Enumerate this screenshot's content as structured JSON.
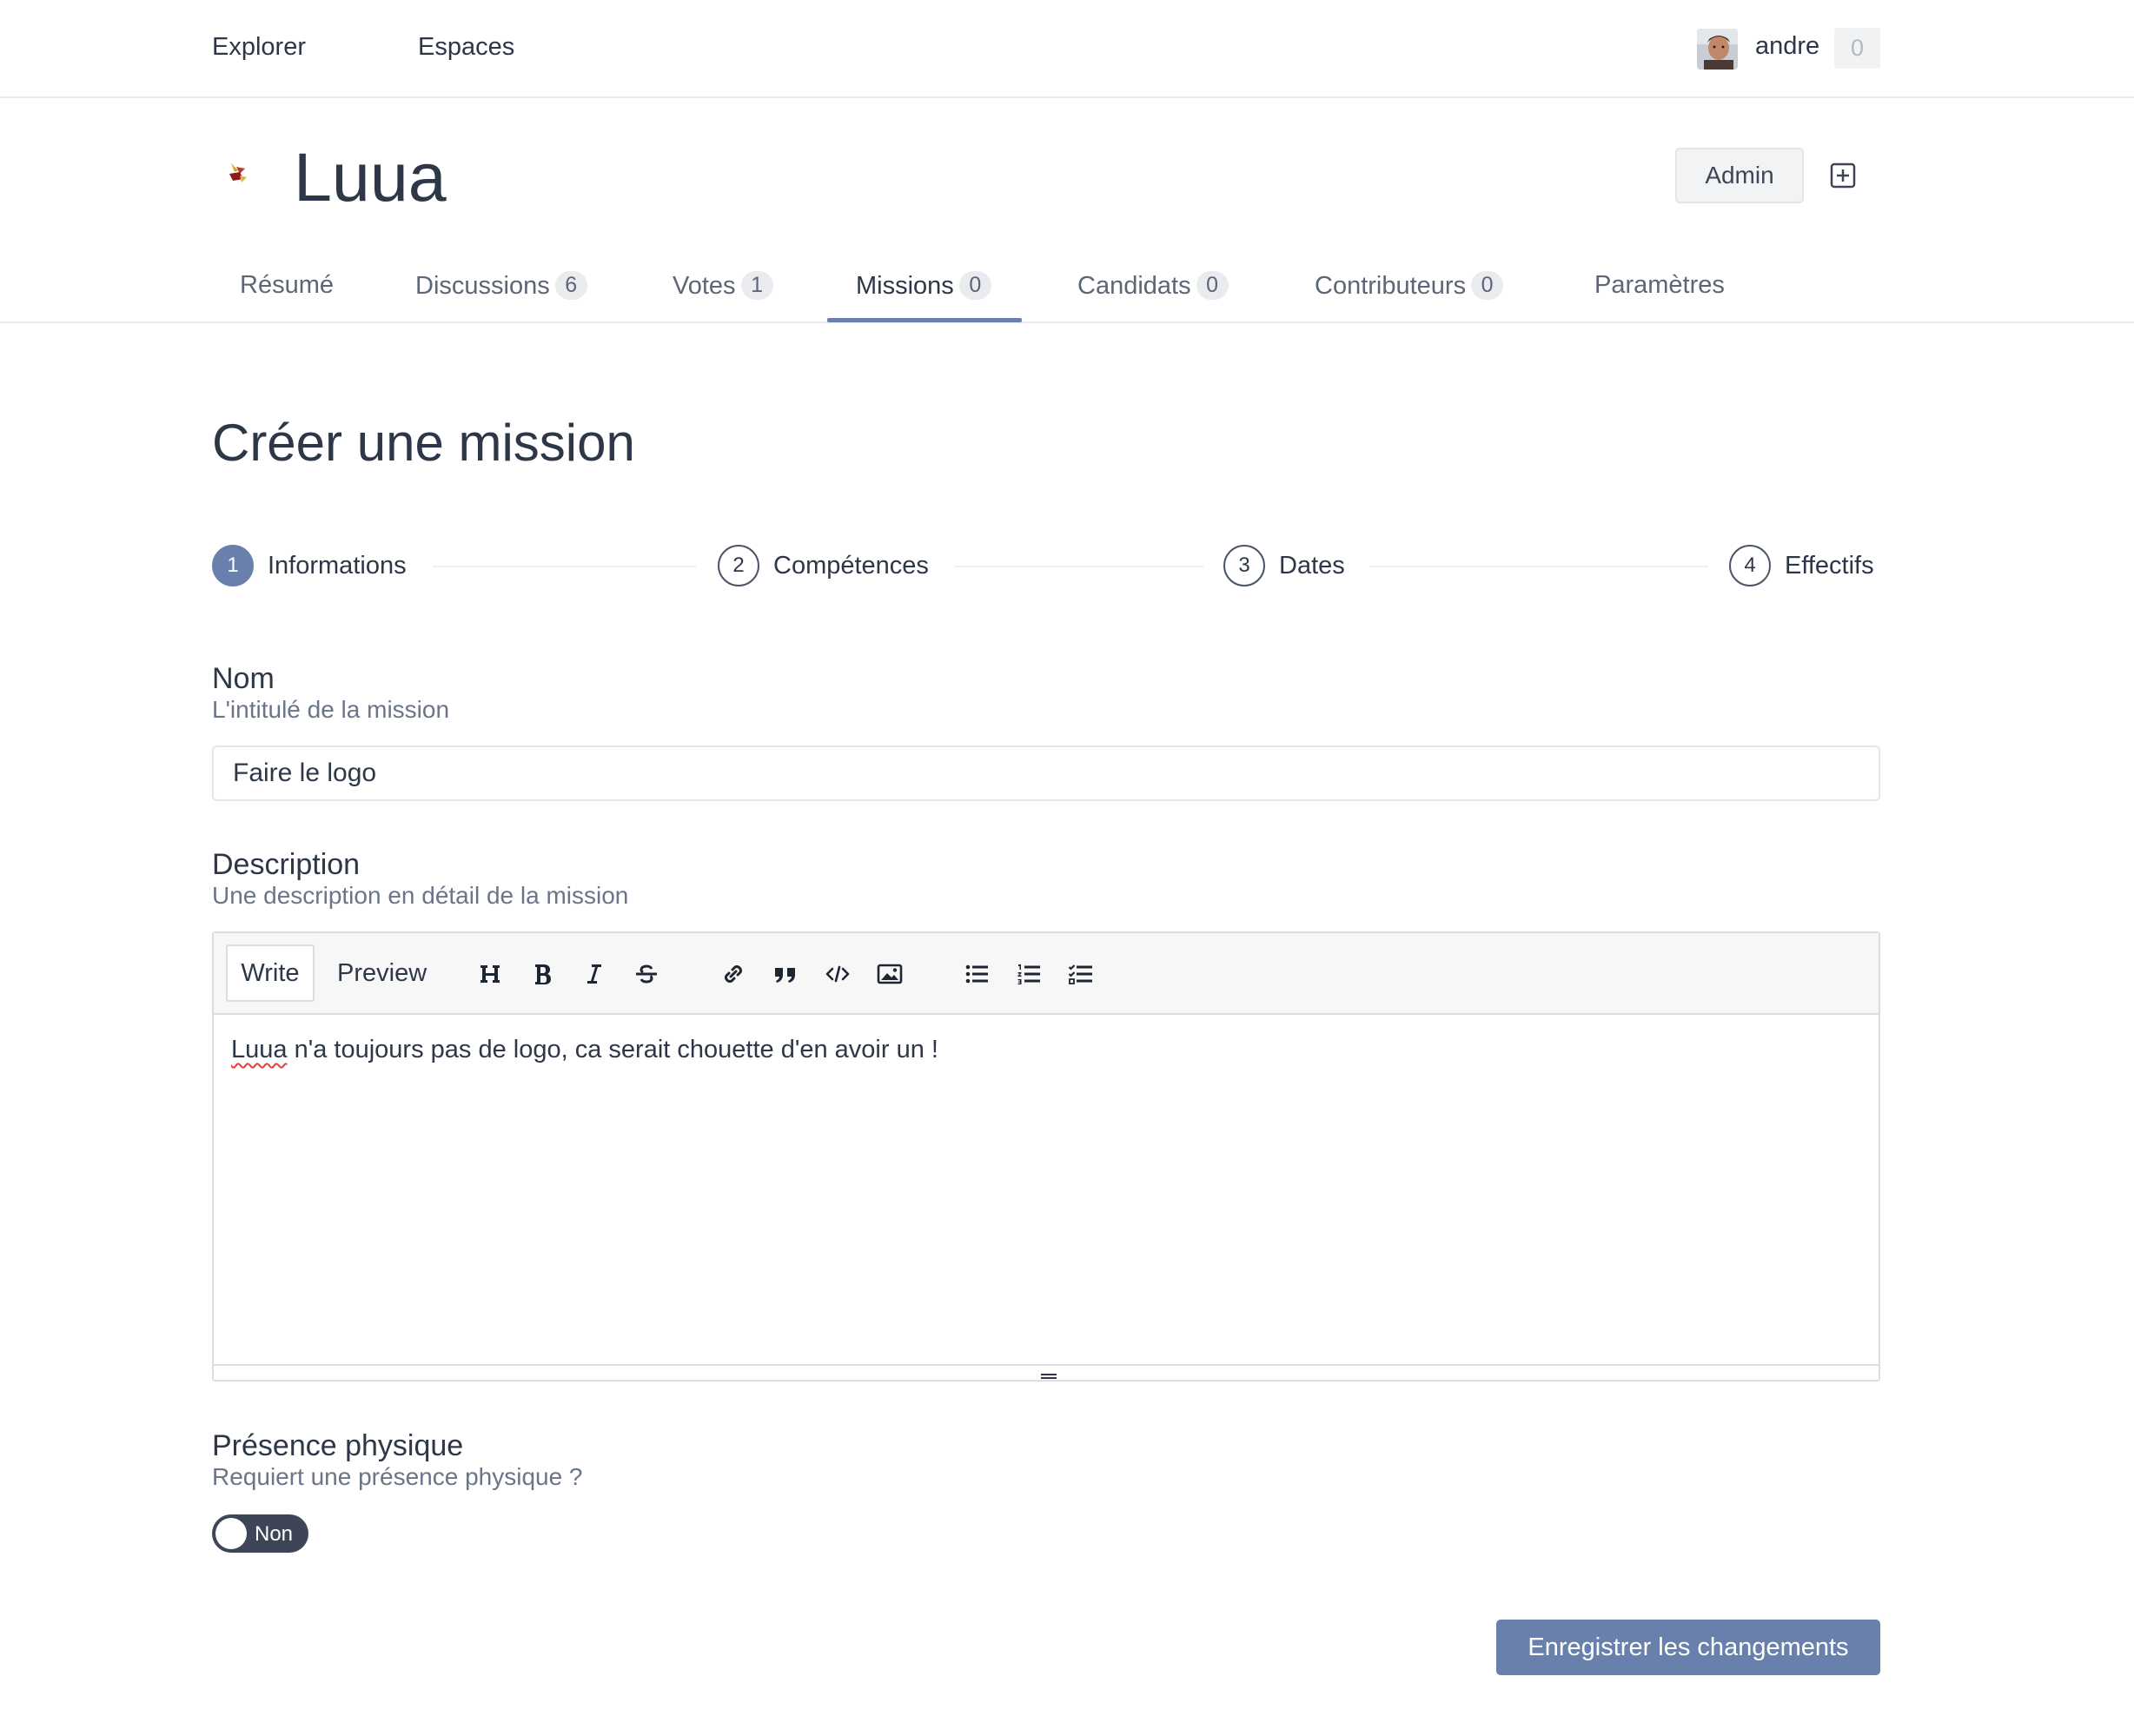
{
  "topnav": {
    "links": [
      "Explorer",
      "Espaces"
    ],
    "username": "andre",
    "notification_count": "0"
  },
  "space": {
    "title": "Luua",
    "admin_label": "Admin"
  },
  "tabs": [
    {
      "label": "Résumé",
      "badge": null
    },
    {
      "label": "Discussions",
      "badge": "6"
    },
    {
      "label": "Votes",
      "badge": "1"
    },
    {
      "label": "Missions",
      "badge": "0",
      "active": true
    },
    {
      "label": "Candidats",
      "badge": "0"
    },
    {
      "label": "Contributeurs",
      "badge": "0"
    },
    {
      "label": "Paramètres",
      "badge": null
    }
  ],
  "page": {
    "title": "Créer une mission"
  },
  "steps": [
    {
      "number": "1",
      "label": "Informations",
      "active": true
    },
    {
      "number": "2",
      "label": "Compétences"
    },
    {
      "number": "3",
      "label": "Dates"
    },
    {
      "number": "4",
      "label": "Effectifs"
    }
  ],
  "form": {
    "name": {
      "label": "Nom",
      "help": "L'intitulé de la mission",
      "value": "Faire le logo"
    },
    "description": {
      "label": "Description",
      "help": "Une description en détail de la mission",
      "write_tab": "Write",
      "preview_tab": "Preview",
      "value_first_word": "Luua",
      "value_rest": " n'a toujours pas de logo, ca serait chouette d'en avoir un !"
    },
    "presence": {
      "label": "Présence physique",
      "help": "Requiert une présence physique ?",
      "toggle_text": "Non",
      "checked": false
    },
    "submit_label": "Enregistrer les changements"
  },
  "colors": {
    "accent": "#6880ab",
    "text": "#2d3748",
    "muted": "#6b7588",
    "toggle_off": "#3d4556"
  },
  "toolbar_icons": [
    "heading-icon",
    "bold-icon",
    "italic-icon",
    "strikethrough-icon",
    "link-icon",
    "quote-icon",
    "code-icon",
    "image-icon",
    "unordered-list-icon",
    "ordered-list-icon",
    "checklist-icon"
  ]
}
